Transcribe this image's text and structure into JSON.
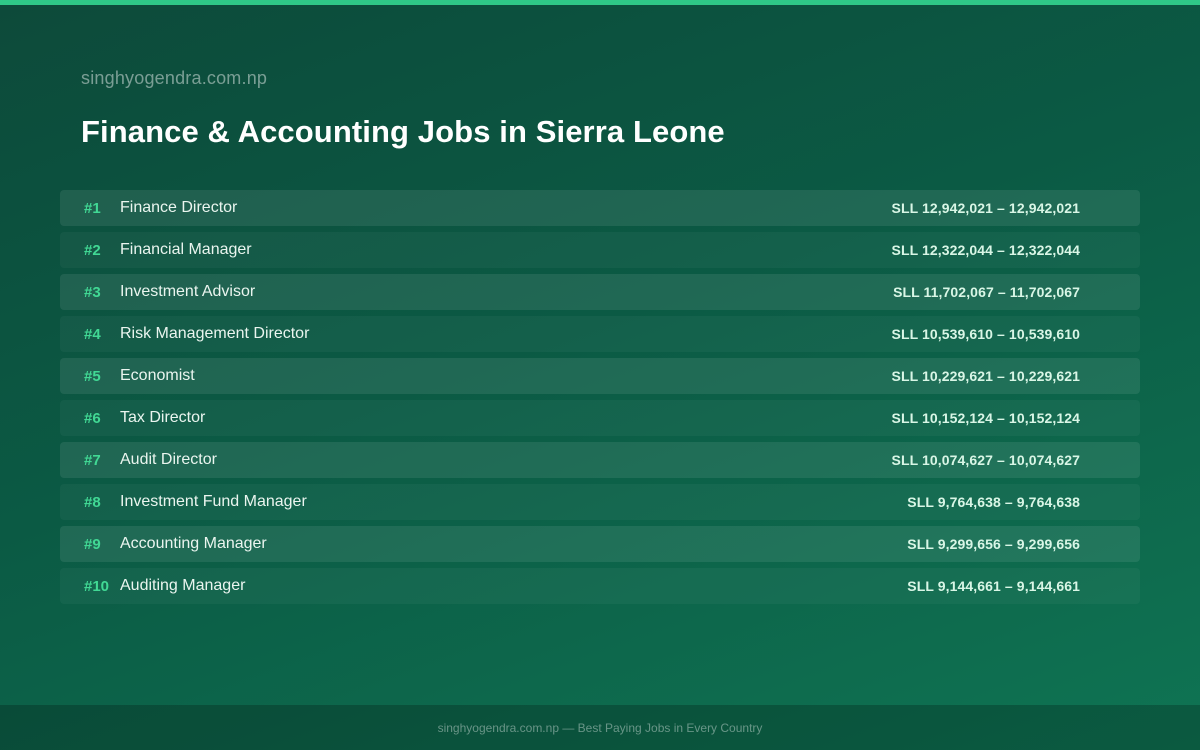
{
  "header": {
    "site": "singhyogendra.com.np",
    "title": "Finance & Accounting Jobs in Sierra Leone"
  },
  "colors": {
    "accent": "#2fc887",
    "rank": "#41d894",
    "background_start": "#0d4a3a",
    "background_end": "#0f7453"
  },
  "jobs": [
    {
      "rank": "#1",
      "title": "Finance Director",
      "salary": "SLL 12,942,021 – 12,942,021"
    },
    {
      "rank": "#2",
      "title": "Financial Manager",
      "salary": "SLL 12,322,044 – 12,322,044"
    },
    {
      "rank": "#3",
      "title": "Investment Advisor",
      "salary": "SLL 11,702,067 – 11,702,067"
    },
    {
      "rank": "#4",
      "title": "Risk Management Director",
      "salary": "SLL 10,539,610 – 10,539,610"
    },
    {
      "rank": "#5",
      "title": "Economist",
      "salary": "SLL 10,229,621 – 10,229,621"
    },
    {
      "rank": "#6",
      "title": "Tax Director",
      "salary": "SLL 10,152,124 – 10,152,124"
    },
    {
      "rank": "#7",
      "title": "Audit Director",
      "salary": "SLL 10,074,627 – 10,074,627"
    },
    {
      "rank": "#8",
      "title": "Investment Fund Manager",
      "salary": "SLL 9,764,638 – 9,764,638"
    },
    {
      "rank": "#9",
      "title": "Accounting Manager",
      "salary": "SLL 9,299,656 – 9,299,656"
    },
    {
      "rank": "#10",
      "title": "Auditing Manager",
      "salary": "SLL 9,144,661 – 9,144,661"
    }
  ],
  "footer": {
    "text": "singhyogendra.com.np — Best Paying Jobs in Every Country"
  }
}
